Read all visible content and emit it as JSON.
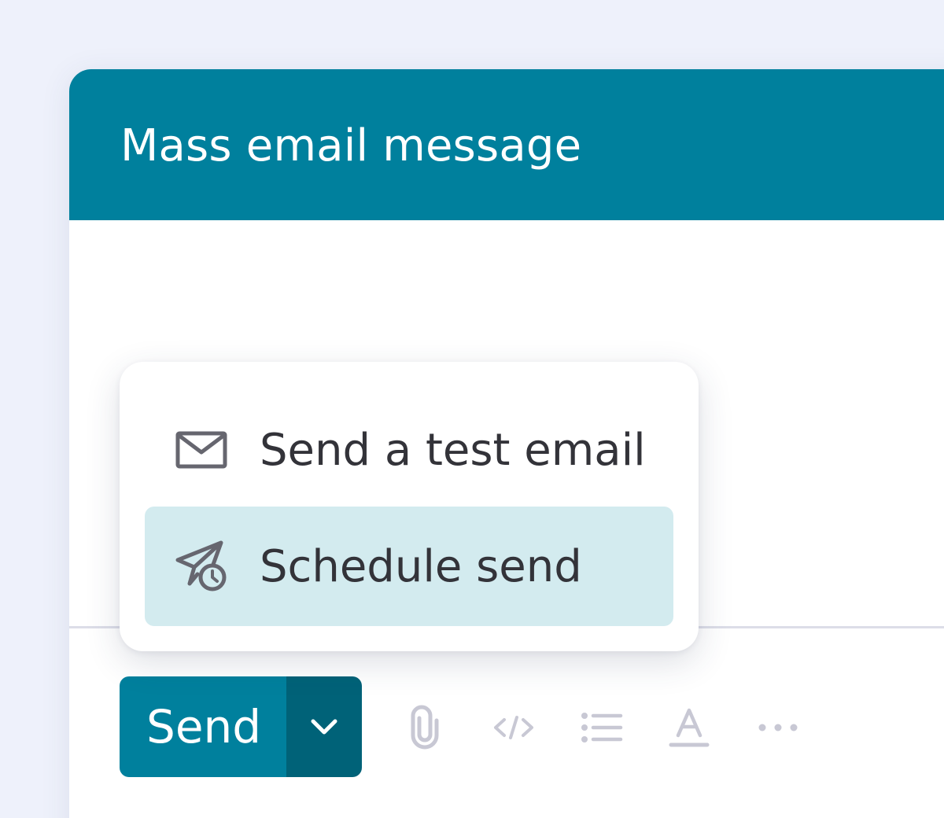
{
  "window": {
    "title": "Mass email message"
  },
  "menu": {
    "items": [
      {
        "label": "Send a test email",
        "icon": "mail-icon"
      },
      {
        "label": "Schedule send",
        "icon": "schedule-send-icon"
      }
    ]
  },
  "footer": {
    "send_label": "Send",
    "toolbar_icons": [
      "attach-icon",
      "code-icon",
      "list-icon",
      "text-color-icon",
      "more-icon"
    ]
  },
  "colors": {
    "header": "#00809d",
    "send_button": "#00809d",
    "send_toggle": "#006278",
    "selected_item": "#d3ebef",
    "background": "#eef1fb"
  }
}
